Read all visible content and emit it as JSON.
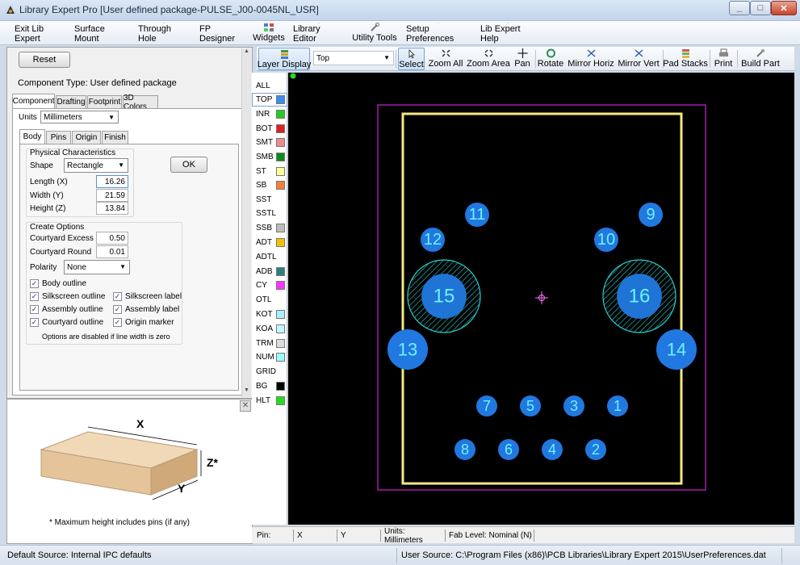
{
  "window": {
    "title": "Library Expert Pro [User defined package-PULSE_J00-0045NL_USR]"
  },
  "menu": {
    "items": [
      {
        "label": "Exit Lib Expert",
        "icon": "exit-icon"
      },
      {
        "label": "Surface Mount",
        "icon": "chip-icon"
      },
      {
        "label": "Through Hole",
        "icon": "chip-icon"
      },
      {
        "label": "FP Designer",
        "icon": "fp-designer-icon"
      },
      {
        "label": "Widgets",
        "icon": "widgets-icon"
      },
      {
        "label": "Library Editor",
        "icon": "library-editor-icon"
      },
      {
        "label": "Utility Tools",
        "icon": "utility-tools-icon"
      },
      {
        "label": "Setup Preferences",
        "icon": "setup-preferences-icon"
      },
      {
        "label": "Lib Expert Help",
        "icon": "help-icon"
      }
    ]
  },
  "left": {
    "reset": "Reset",
    "component_type": "Component Type: User defined package",
    "tabs": [
      "Component",
      "Drafting",
      "Footprint",
      "3D Colors"
    ],
    "units_label": "Units",
    "units_value": "Millimeters",
    "subtabs": [
      "Body",
      "Pins",
      "Origin",
      "Finish"
    ],
    "physical": {
      "title": "Physical Characteristics",
      "shape_label": "Shape",
      "shape_value": "Rectangle",
      "length_label": "Length (X)",
      "length": "16.26",
      "width_label": "Width (Y)",
      "width": "21.59",
      "height_label": "Height (Z)",
      "height": "13.84",
      "ok": "OK"
    },
    "create": {
      "title": "Create Options",
      "excess_label": "Courtyard Excess",
      "excess": "0.50",
      "round_label": "Courtyard Round",
      "round": "0.01",
      "polarity_label": "Polarity",
      "polarity": "None",
      "body_outline": "Body outline",
      "silk_outline": "Silkscreen outline",
      "silk_label": "Silkscreen label",
      "assy_outline": "Assembly outline",
      "assy_label": "Assembly label",
      "court_outline": "Courtyard outline",
      "origin_marker": "Origin marker",
      "note": "Options are disabled if line width is zero"
    }
  },
  "preview": {
    "x": "X",
    "y": "Y",
    "z": "Z*",
    "note": "*  Maximum height includes pins (if any)"
  },
  "toolbar": {
    "layer_display": "Layer Display",
    "layer_value": "Top",
    "buttons": [
      "Select",
      "Zoom All",
      "Zoom Area",
      "Pan",
      "Rotate",
      "Mirror Horiz",
      "Mirror Vert",
      "Pad Stacks",
      "Print",
      "Build Part"
    ]
  },
  "layers": [
    {
      "name": "ALL",
      "color": ""
    },
    {
      "name": "TOP",
      "color": "#3b8de8"
    },
    {
      "name": "INR",
      "color": "#22cc22"
    },
    {
      "name": "BOT",
      "color": "#e02020"
    },
    {
      "name": "SMT",
      "color": "#f08a8a"
    },
    {
      "name": "SMB",
      "color": "#0f8a1a"
    },
    {
      "name": "ST",
      "color": "#ffff99"
    },
    {
      "name": "SB",
      "color": "#f0803c"
    },
    {
      "name": "SST",
      "color": ""
    },
    {
      "name": "SSTL",
      "color": ""
    },
    {
      "name": "SSB",
      "color": "#bdbdbd"
    },
    {
      "name": "ADT",
      "color": "#f5c000"
    },
    {
      "name": "ADTL",
      "color": ""
    },
    {
      "name": "ADB",
      "color": "#2f7f7f"
    },
    {
      "name": "CY",
      "color": "#ff33ff"
    },
    {
      "name": "OTL",
      "color": ""
    },
    {
      "name": "KOT",
      "color": "#a8f0ff"
    },
    {
      "name": "KOA",
      "color": "#c2f7ff"
    },
    {
      "name": "TRM",
      "color": "#dddddd"
    },
    {
      "name": "NUM",
      "color": "#99ffff"
    },
    {
      "name": "GRID",
      "color": ""
    },
    {
      "name": "BG",
      "color": "#000000"
    },
    {
      "name": "HLT",
      "color": "#22dd22"
    }
  ],
  "pads": [
    "1",
    "2",
    "3",
    "4",
    "5",
    "6",
    "7",
    "8",
    "9",
    "10",
    "11",
    "12",
    "13",
    "14",
    "15",
    "16"
  ],
  "status": {
    "pin": "Pin:",
    "x": "X",
    "y": "Y",
    "units": "Units: Millimeters",
    "fab": "Fab Level: Nominal (N)",
    "default_source": "Default Source:  Internal IPC defaults",
    "user_source": "User Source:  C:\\Program Files (x86)\\PCB Libraries\\Library Expert 2015\\UserPreferences.dat"
  }
}
